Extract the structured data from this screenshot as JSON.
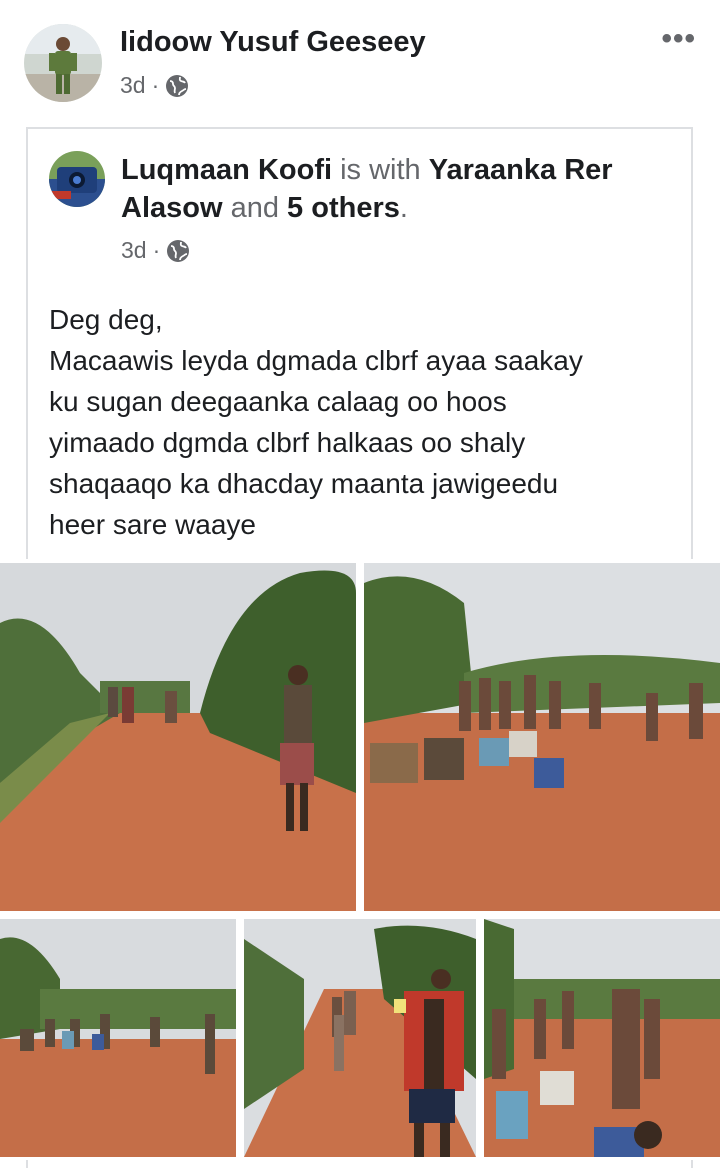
{
  "post": {
    "author_name": "Iidoow Yusuf Geeseey",
    "timestamp": "3d",
    "separator": "·",
    "visibility_icon": "globe-icon",
    "more_label": "•••"
  },
  "shared_post": {
    "author_name": "Luqmaan Koofi",
    "is_with": "is with",
    "tagged_name": "Yaraanka Rer Alasow",
    "and": "and",
    "others": "5 others",
    "period": ".",
    "timestamp": "3d",
    "separator": "·",
    "visibility_icon": "globe-icon",
    "text_lines": [
      "Deg deg,",
      "Macaawis leyda dgmada clbrf ayaa saakay",
      "ku sugan deegaanka calaag oo hoos",
      "yimaado dgmda clbrf halkaas oo shaly",
      "shaqaaqo ka dhacday maanta jawigeedu",
      "heer sare waaye"
    ]
  },
  "photos": [
    {
      "subject": "man walking on red dirt road"
    },
    {
      "subject": "group of people seated on the ground"
    },
    {
      "subject": "crowd gathered near trees"
    },
    {
      "subject": "men walking on path"
    },
    {
      "subject": "people sitting and standing"
    }
  ],
  "colors": {
    "primary_text": "#1c1e21",
    "secondary_text": "#65676b",
    "card_border": "#dddfe2",
    "dirt_road": "#c8714a",
    "sky": "#d9dde0",
    "foliage": "#4f6f3a"
  }
}
